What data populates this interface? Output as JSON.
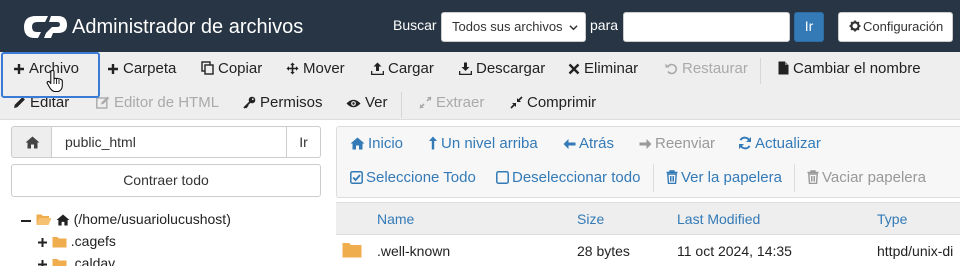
{
  "header": {
    "title": "Administrador de archivos",
    "search_label": "Buscar",
    "search_scope": "Todos sus archivos",
    "para_label": "para",
    "search_value": "",
    "go_label": "Ir",
    "settings_label": "Configuración",
    "colors": {
      "bar": "#273544",
      "primary": "#337ab7"
    }
  },
  "toolbar": {
    "row1": [
      {
        "label": "Archivo",
        "icon": "plus-icon"
      },
      {
        "label": "Carpeta",
        "icon": "plus-icon"
      },
      {
        "label": "Copiar",
        "icon": "copy-icon"
      },
      {
        "label": "Mover",
        "icon": "move-icon"
      },
      {
        "label": "Cargar",
        "icon": "upload-icon"
      },
      {
        "label": "Descargar",
        "icon": "download-icon"
      },
      {
        "label": "Eliminar",
        "icon": "times-icon"
      },
      {
        "label": "Restaurar",
        "icon": "undo-icon",
        "disabled": true
      },
      {
        "label": "Cambiar el nombre",
        "icon": "file-icon"
      }
    ],
    "row2": [
      {
        "label": "Editar",
        "icon": "pencil-icon"
      },
      {
        "label": "Editor de HTML",
        "icon": "edit-icon",
        "disabled": true
      },
      {
        "label": "Permisos",
        "icon": "key-icon"
      },
      {
        "label": "Ver",
        "icon": "eye-icon"
      },
      {
        "label": "Extraer",
        "icon": "expand-icon",
        "disabled": true
      },
      {
        "label": "Comprimir",
        "icon": "compress-icon"
      }
    ]
  },
  "left_panel": {
    "path_value": "public_html",
    "go_label": "Ir",
    "collapse_label": "Contraer todo",
    "tree": [
      {
        "label": "(/home/usuariolucushost)"
      },
      {
        "label": ".cagefs"
      },
      {
        "label": ".caldav"
      }
    ]
  },
  "nav": {
    "row1": [
      {
        "label": "Inicio",
        "icon": "home-icon"
      },
      {
        "label": "Un nivel arriba",
        "icon": "level-up-icon"
      },
      {
        "label": "Atrás",
        "icon": "arrow-left-icon"
      },
      {
        "label": "Reenviar",
        "icon": "arrow-right-icon",
        "disabled": true
      },
      {
        "label": "Actualizar",
        "icon": "refresh-icon"
      }
    ],
    "row2": [
      {
        "label": "Seleccione Todo",
        "icon": "check-square-icon"
      },
      {
        "label": "Deseleccionar todo",
        "icon": "square-icon"
      },
      {
        "label": "Ver la papelera",
        "icon": "trash-icon"
      },
      {
        "label": "Vaciar papelera",
        "icon": "trash-icon",
        "disabled": true
      }
    ]
  },
  "table": {
    "columns": [
      "Name",
      "Size",
      "Last Modified",
      "Type"
    ],
    "rows": [
      {
        "name": ".well-known",
        "size": "28 bytes",
        "modified": "11 oct 2024, 14:35",
        "type": "httpd/unix-di"
      }
    ]
  }
}
